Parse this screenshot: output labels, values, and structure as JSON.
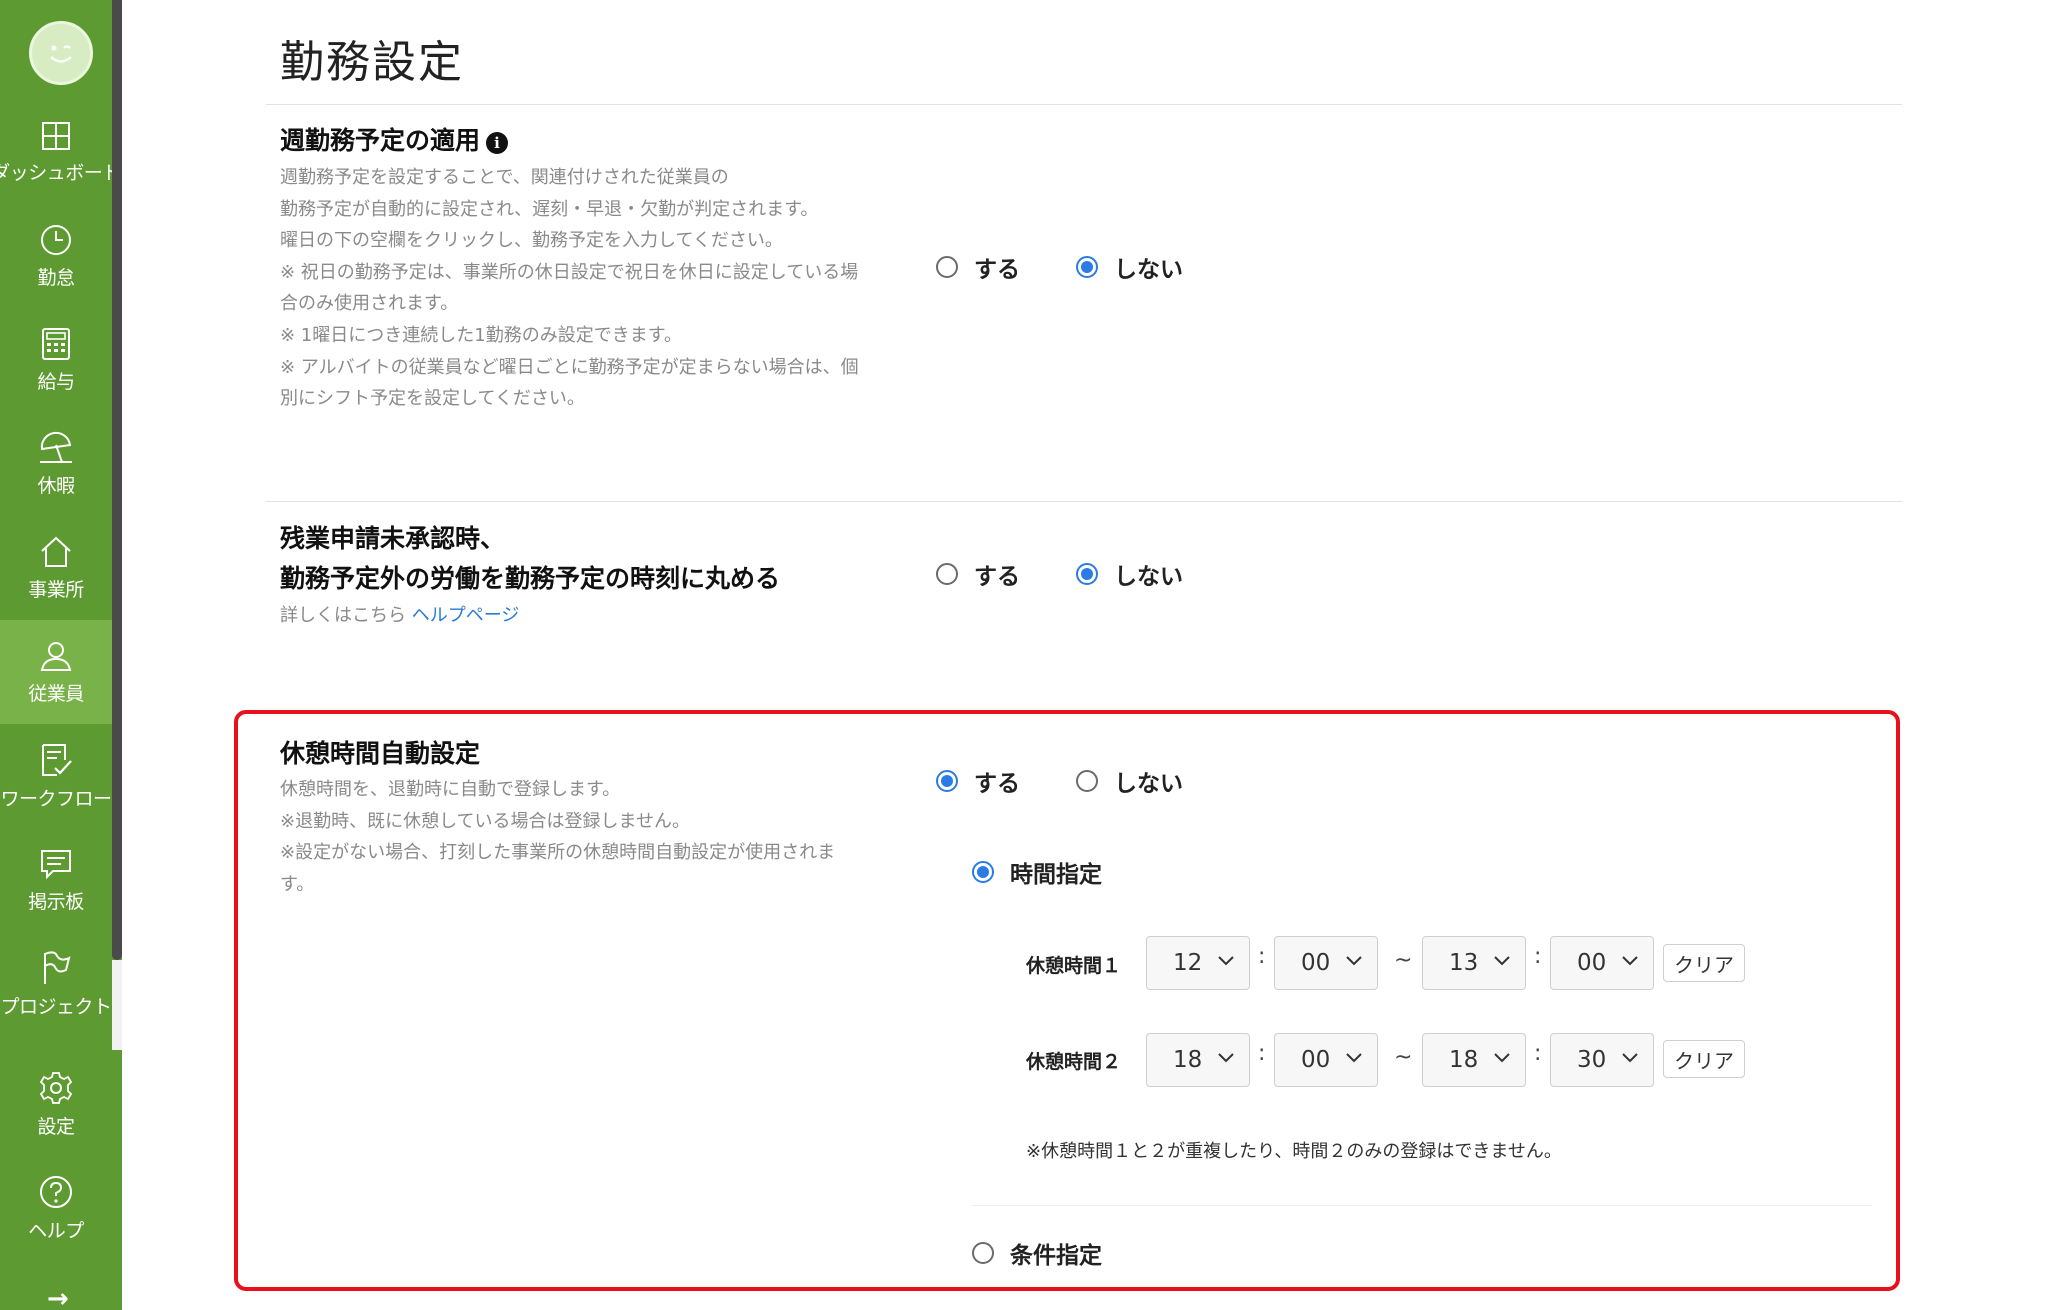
{
  "sidebar": {
    "items": [
      {
        "id": "dashboard",
        "label": "ダッシュボード",
        "icon": "dashboard-icon"
      },
      {
        "id": "attendance",
        "label": "勤怠",
        "icon": "clock-icon"
      },
      {
        "id": "payroll",
        "label": "給与",
        "icon": "calculator-icon"
      },
      {
        "id": "vacation",
        "label": "休暇",
        "icon": "beach-umbrella-icon"
      },
      {
        "id": "office",
        "label": "事業所",
        "icon": "home-icon"
      },
      {
        "id": "employee",
        "label": "従業員",
        "icon": "person-icon",
        "active": true
      },
      {
        "id": "workflow",
        "label": "ワークフロー",
        "icon": "checklist-icon"
      },
      {
        "id": "board",
        "label": "掲示板",
        "icon": "chat-icon"
      },
      {
        "id": "project",
        "label": "プロジェクト",
        "icon": "flag-icon"
      },
      {
        "id": "settings",
        "label": "設定",
        "icon": "gear-icon"
      },
      {
        "id": "help",
        "label": "ヘルプ",
        "icon": "help-icon"
      }
    ],
    "expand_arrow": "→"
  },
  "page": {
    "title": "勤務設定"
  },
  "weekly_schedule": {
    "title": "週勤務予定の適用",
    "info": "i",
    "desc": [
      "週勤務予定を設定することで、関連付けされた従業員の",
      "勤務予定が自動的に設定され、遅刻・早退・欠勤が判定されます。",
      "曜日の下の空欄をクリックし、勤務予定を入力してください。",
      "※ 祝日の勤務予定は、事業所の休日設定で祝日を休日に設定している場",
      "合のみ使用されます。",
      "※ 1曜日につき連続した1勤務のみ設定できます。",
      "※ アルバイトの従業員など曜日ごとに勤務予定が定まらない場合は、個",
      "別にシフト予定を設定してください。"
    ],
    "yes": "する",
    "no": "しない",
    "selected": "no"
  },
  "overtime": {
    "title_line1": "残業申請未承認時、",
    "title_line2": "勤務予定外の労働を勤務予定の時刻に丸める",
    "desc_prefix": "詳しくはこちら",
    "help_link": "ヘルプページ",
    "yes": "する",
    "no": "しない",
    "selected": "no"
  },
  "break_auto": {
    "title": "休憩時間自動設定",
    "desc": [
      "休憩時間を、退勤時に自動で登録します。",
      "※退勤時、既に休憩している場合は登録しません。",
      "※設定がない場合、打刻した事業所の休憩時間自動設定が使用されま",
      "す。"
    ],
    "yes": "する",
    "no": "しない",
    "selected": "yes",
    "mode_time": "時間指定",
    "mode_condition": "条件指定",
    "mode_selected": "time",
    "breaks": [
      {
        "label": "休憩時間１",
        "start_h": "12",
        "start_m": "00",
        "end_h": "13",
        "end_m": "00"
      },
      {
        "label": "休憩時間２",
        "start_h": "18",
        "start_m": "00",
        "end_h": "18",
        "end_m": "30"
      }
    ],
    "colon": ":",
    "tilde": "~",
    "clear_label": "クリア",
    "note": "※休憩時間１と２が重複したり、時間２のみの登録はできません。"
  }
}
